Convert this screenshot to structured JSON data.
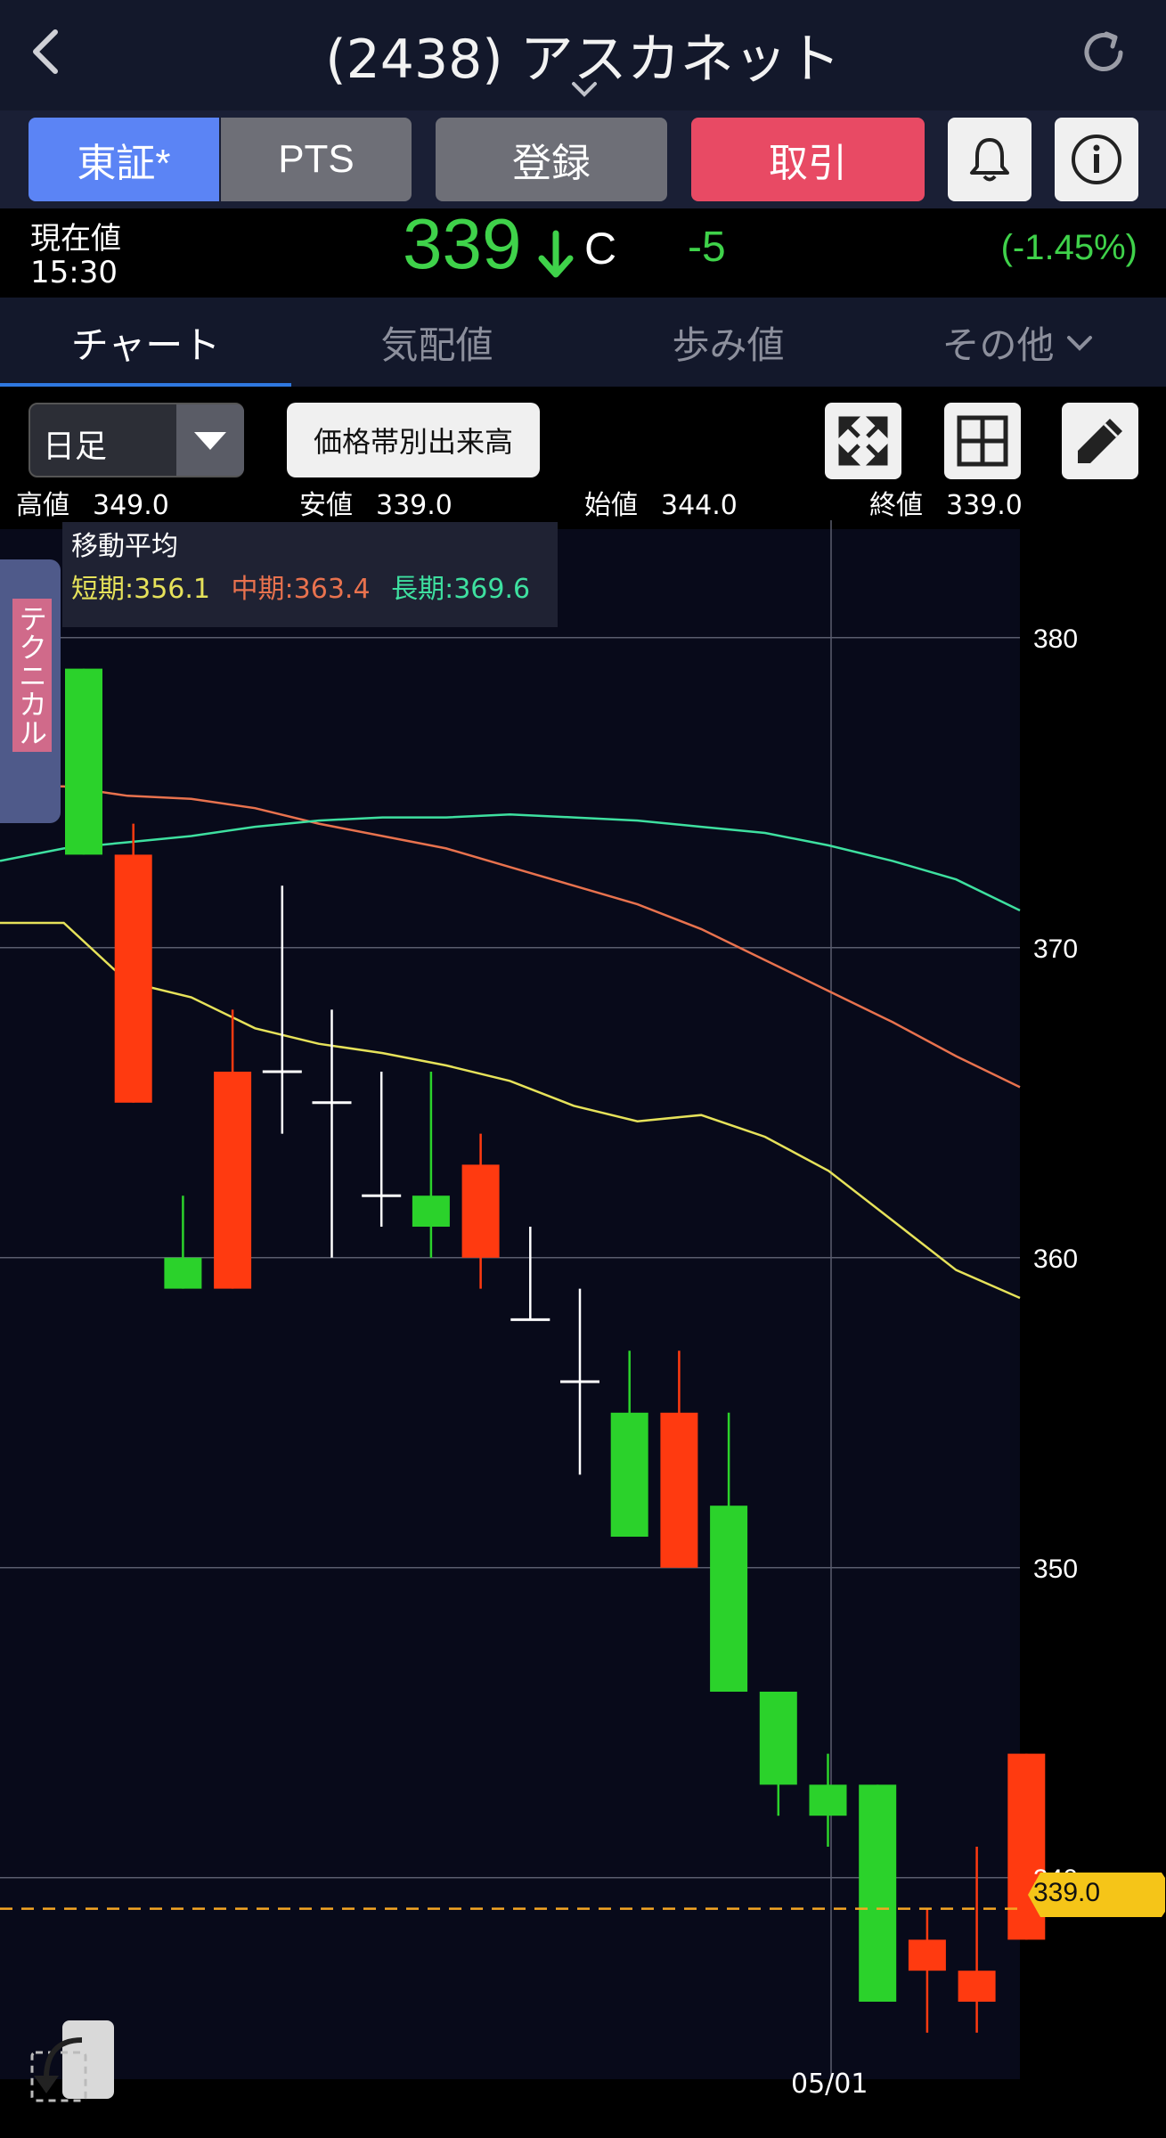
{
  "header": {
    "title": "(2438) アスカネット"
  },
  "market_buttons": {
    "tosho_label": "東証*",
    "pts_label": "PTS",
    "register_label": "登録",
    "trade_label": "取引"
  },
  "price": {
    "label": "現在値",
    "time": "15:30",
    "value": "339",
    "flag": "C",
    "change": "-5",
    "change_pct": "(-1.45%)"
  },
  "tabs": [
    {
      "label": "チャート",
      "active": true
    },
    {
      "label": "気配値"
    },
    {
      "label": "歩み値"
    },
    {
      "label": "その他"
    }
  ],
  "chart_controls": {
    "period": "日足",
    "volume_profile_label": "価格帯別出来高"
  },
  "ohlc": {
    "high_label": "高値",
    "high": "349.0",
    "low_label": "安値",
    "low": "339.0",
    "open_label": "始値",
    "open": "344.0",
    "close_label": "終値",
    "close": "339.0"
  },
  "ma_legend": {
    "title": "移動平均",
    "short": "短期:356.1",
    "mid": "中期:363.4",
    "long": "長期:369.6"
  },
  "side_tab": {
    "label": "テクニカル"
  },
  "colors": {
    "up": "#2bd22b",
    "down": "#ff3a10",
    "short_ma": "#e6e25a",
    "mid_ma": "#e8724e",
    "long_ma": "#3ee0a0",
    "price_tag": "#f5c518"
  },
  "chart_data": {
    "type": "candlestick",
    "y_ticks": [
      340,
      350,
      360,
      370,
      380
    ],
    "ylim": [
      333.5,
      383.5
    ],
    "x_tick_label": "05/01",
    "current_price_label": "339.0",
    "current_price": 339.0,
    "candles": [
      {
        "open": 373.0,
        "high": 379.0,
        "low": 373.0,
        "close": 379.0
      },
      {
        "open": 373.0,
        "high": 374.0,
        "low": 365.0,
        "close": 365.0
      },
      {
        "open": 359.0,
        "high": 362.0,
        "low": 359.0,
        "close": 360.0
      },
      {
        "open": 366.0,
        "high": 368.0,
        "low": 359.0,
        "close": 359.0
      },
      {
        "open": 366.0,
        "high": 372.0,
        "low": 364.0,
        "close": 366.0
      },
      {
        "open": 365.0,
        "high": 368.0,
        "low": 360.0,
        "close": 365.0
      },
      {
        "open": 362.0,
        "high": 366.0,
        "low": 361.0,
        "close": 362.0
      },
      {
        "open": 361.0,
        "high": 366.0,
        "low": 360.0,
        "close": 362.0
      },
      {
        "open": 363.0,
        "high": 364.0,
        "low": 359.0,
        "close": 360.0
      },
      {
        "open": 358.0,
        "high": 361.0,
        "low": 358.0,
        "close": 358.0
      },
      {
        "open": 356.0,
        "high": 359.0,
        "low": 353.0,
        "close": 356.0
      },
      {
        "open": 351.0,
        "high": 357.0,
        "low": 351.0,
        "close": 355.0
      },
      {
        "open": 355.0,
        "high": 357.0,
        "low": 350.0,
        "close": 350.0
      },
      {
        "open": 346.0,
        "high": 355.0,
        "low": 346.0,
        "close": 352.0
      },
      {
        "open": 343.0,
        "high": 346.0,
        "low": 342.0,
        "close": 346.0
      },
      {
        "open": 342.0,
        "high": 344.0,
        "low": 341.0,
        "close": 343.0
      },
      {
        "open": 336.0,
        "high": 343.0,
        "low": 336.0,
        "close": 343.0
      },
      {
        "open": 338.0,
        "high": 339.0,
        "low": 335.0,
        "close": 337.0
      },
      {
        "open": 337.0,
        "high": 341.0,
        "low": 335.0,
        "close": 336.0
      },
      {
        "open": 344.0,
        "high": 344.0,
        "low": 338.0,
        "close": 338.0
      }
    ],
    "ma_series": [
      {
        "name": "短期",
        "values": [
          370.8,
          370.8,
          368.9,
          368.4,
          367.4,
          366.9,
          366.6,
          366.2,
          365.7,
          364.9,
          364.4,
          364.6,
          363.9,
          362.8,
          361.2,
          359.6,
          358.7
        ]
      },
      {
        "name": "中期",
        "values": [
          375.2,
          375.2,
          374.9,
          374.8,
          374.5,
          374.0,
          373.6,
          373.2,
          372.6,
          372.0,
          371.4,
          370.6,
          369.6,
          368.6,
          367.6,
          366.5,
          365.5
        ]
      },
      {
        "name": "長期",
        "values": [
          372.8,
          373.2,
          373.4,
          373.6,
          373.9,
          374.1,
          374.2,
          374.2,
          374.3,
          374.2,
          374.1,
          373.9,
          373.7,
          373.3,
          372.8,
          372.2,
          371.2
        ]
      }
    ]
  }
}
